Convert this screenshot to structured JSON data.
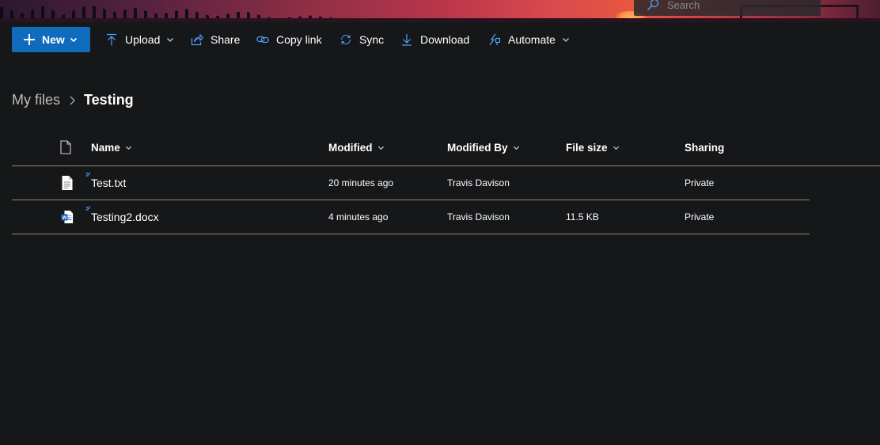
{
  "search": {
    "placeholder": "Search"
  },
  "toolbar": {
    "new_label": "New",
    "upload_label": "Upload",
    "share_label": "Share",
    "copy_link_label": "Copy link",
    "sync_label": "Sync",
    "download_label": "Download",
    "automate_label": "Automate"
  },
  "breadcrumb": {
    "parent": "My files",
    "current": "Testing"
  },
  "table": {
    "headers": {
      "name": "Name",
      "modified": "Modified",
      "modified_by": "Modified By",
      "file_size": "File size",
      "sharing": "Sharing"
    },
    "rows": [
      {
        "name": "Test.txt",
        "type_icon": "text-file-icon",
        "modified": "20 minutes ago",
        "modified_by": "Travis Davison",
        "file_size": "",
        "sharing": "Private"
      },
      {
        "name": "Testing2.docx",
        "type_icon": "word-file-icon",
        "modified": "4 minutes ago",
        "modified_by": "Travis Davison",
        "file_size": "11.5 KB",
        "sharing": "Private"
      }
    ]
  },
  "colors": {
    "background": "#161719",
    "accent": "#0f6cbd",
    "icon_blue": "#4da3ff",
    "divider": "#8a8f6b"
  }
}
